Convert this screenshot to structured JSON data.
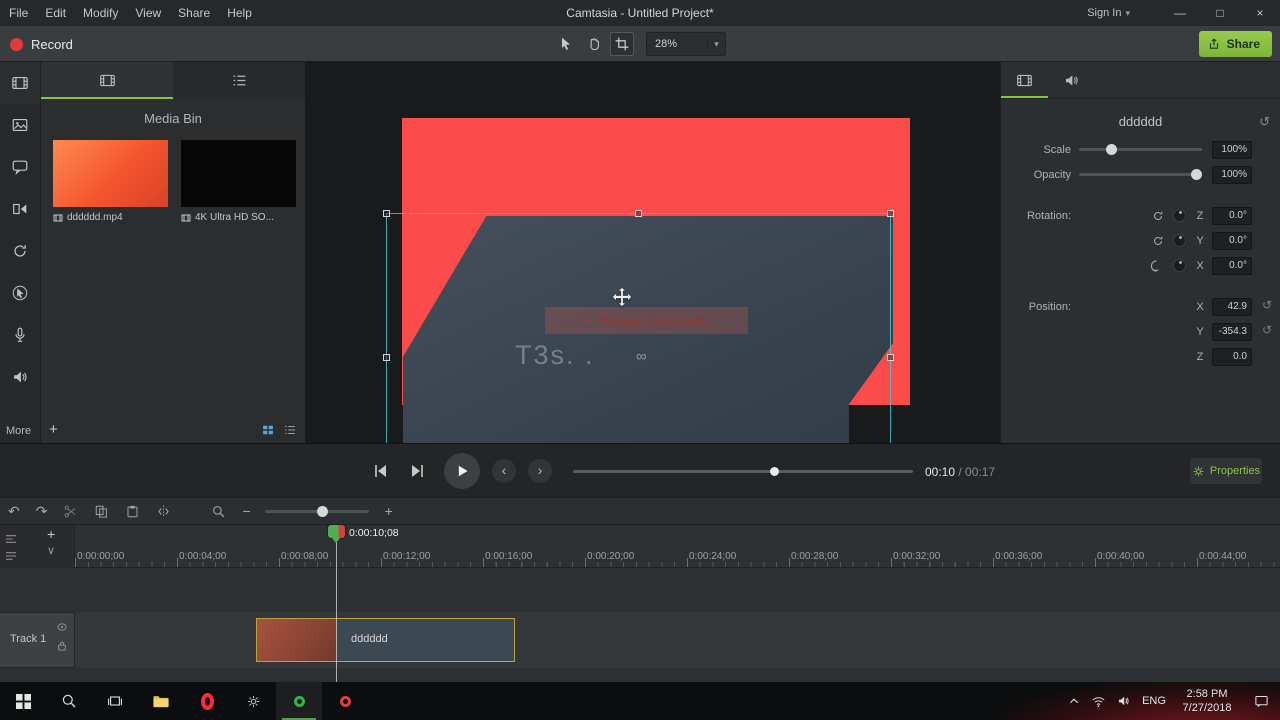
{
  "colors": {
    "accent_green": "#86c440",
    "record_red": "#e23b3b",
    "selection_teal": "#3fb6bf",
    "clip_border": "#b9a23f",
    "preview_red": "#fb4b4a"
  },
  "menubar": {
    "items": [
      "File",
      "Edit",
      "Modify",
      "View",
      "Share",
      "Help"
    ],
    "title": "Camtasia - Untitled Project*",
    "sign_in": "Sign In"
  },
  "toolbar": {
    "record_label": "Record",
    "zoom_value": "28%",
    "share_label": "Share"
  },
  "sidebar": {
    "more_label": "More"
  },
  "media_bin": {
    "title": "Media Bin",
    "items": [
      {
        "label": "dddddd.mp4"
      },
      {
        "label": "4K Ultra HD  SO..."
      }
    ]
  },
  "canvas": {
    "caption_title": "Farman Tariq Salih",
    "caption_sub": "T3s. .",
    "infinity": "∞"
  },
  "playback": {
    "current": "00:10",
    "separator": " / ",
    "total": "00:17",
    "properties_label": "Properties"
  },
  "properties": {
    "title": "dddddd",
    "scale_label": "Scale",
    "scale_value": "100%",
    "opacity_label": "Opacity",
    "opacity_value": "100%",
    "rotation_label": "Rotation:",
    "rotation": [
      {
        "axis": "Z",
        "value": "0.0°"
      },
      {
        "axis": "Y",
        "value": "0.0°"
      },
      {
        "axis": "X",
        "value": "0.0°"
      }
    ],
    "position_label": "Position:",
    "position": [
      {
        "axis": "X",
        "value": "42.9"
      },
      {
        "axis": "Y",
        "value": "-354.3"
      },
      {
        "axis": "Z",
        "value": "0.0"
      }
    ]
  },
  "timeline": {
    "playhead_time": "0:00:10;08",
    "ruler_labels": [
      "0:00:00;00",
      "0:00:04;00",
      "0:00:08;00",
      "0:00:12;00",
      "0:00:16;00",
      "0:00:20;00",
      "0:00:24;00",
      "0:00:28;00",
      "0:00:32;00",
      "0:00:36;00",
      "0:00:40;00",
      "0:00:44;00"
    ],
    "track_label": "Track 1",
    "clip_label": "dddddd"
  },
  "taskbar": {
    "language": "ENG",
    "time": "2:58 PM",
    "date": "7/27/2018"
  },
  "icons": {
    "caret_down": "▾",
    "minimize": "—",
    "maximize": "□",
    "close": "×",
    "undo": "↶",
    "redo": "↷",
    "plus": "+",
    "minus": "−",
    "chevron_down": "∨",
    "reset": "↺",
    "wave": "~",
    "prev": "‹",
    "next": "›"
  }
}
